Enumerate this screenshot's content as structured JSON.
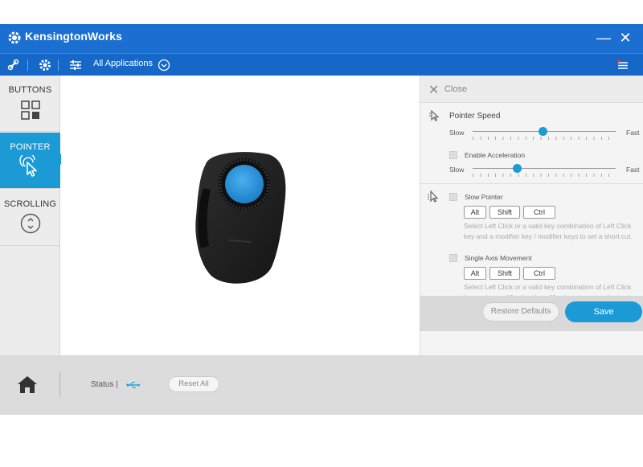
{
  "app": {
    "title": "KensingtonWorks"
  },
  "toolbar": {
    "applications_label": "All Applications"
  },
  "sidebar": {
    "items": [
      {
        "label": "BUTTONS",
        "icon": "grid-icon",
        "active": false
      },
      {
        "label": "POINTER",
        "icon": "pointer-click-icon",
        "active": true
      },
      {
        "label": "SCROLLING",
        "icon": "scroll-icon",
        "active": false
      }
    ]
  },
  "panel": {
    "close_label": "Close",
    "pointer_speed": {
      "title": "Pointer Speed",
      "slow": "Slow",
      "fast": "Fast",
      "value": 0.49
    },
    "acceleration": {
      "label": "Enable Acceleration",
      "slow": "Slow",
      "fast": "Fast",
      "value": 0.31
    },
    "slow_pointer": {
      "label": "Slow Pointer",
      "keys": [
        "Alt",
        "Shift",
        "Ctrl"
      ],
      "hint": "Select Left Click or a valid key combination of Left Click key and a modifier key / modifier keys to set a short cut."
    },
    "single_axis": {
      "label": "Single Axis Movement",
      "keys": [
        "Alt",
        "Shift",
        "Ctrl"
      ],
      "hint": "Select Left Click or a valid key combination of Left Click key and a modifier key / modifier keys to set a short cut."
    },
    "restore_label": "Restore Defaults",
    "save_label": "Save"
  },
  "status_bar": {
    "status_label": "Status |",
    "reset_label": "Reset All"
  },
  "colors": {
    "accent": "#1b9ad6",
    "titlebar": "#1a6fd1"
  }
}
